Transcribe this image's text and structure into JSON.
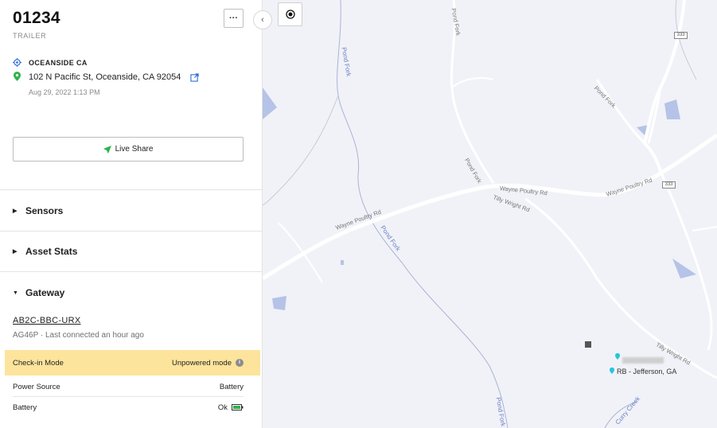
{
  "asset": {
    "id": "01234",
    "type": "TRAILER"
  },
  "location": {
    "name": "OCEANSIDE CA",
    "address": "102 N Pacific St, Oceanside, CA 92054",
    "timestamp": "Aug 29, 2022 1:13 PM"
  },
  "actions": {
    "more_label": "···",
    "live_share_label": "Live Share"
  },
  "sections": [
    {
      "label": "Sensors",
      "expanded": false
    },
    {
      "label": "Asset Stats",
      "expanded": false
    },
    {
      "label": "Gateway",
      "expanded": true
    }
  ],
  "gateway": {
    "id": "AB2C-BBC-URX",
    "meta": "AG46P · Last connected an hour ago",
    "rows": [
      {
        "label": "Check-in Mode",
        "value": "Unpowered mode",
        "highlight": true
      },
      {
        "label": "Power Source",
        "value": "Battery",
        "highlight": false
      },
      {
        "label": "Battery",
        "value": "Ok",
        "highlight": false
      }
    ]
  },
  "map": {
    "roads": [
      "Wayne Poultry Rd",
      "Wayne Poultry Rd",
      "Pond Fork",
      "Pond Fork",
      "Pond Fork",
      "Tilly Wright Rd",
      "Tilly Wright Rd"
    ],
    "creeks": [
      "Pond Fork",
      "Pond Fork",
      "Pond Fork",
      "Curry Creek"
    ],
    "marker_label": "RB - Jefferson, GA",
    "shields": [
      "333",
      "333"
    ]
  },
  "icons": {
    "location": "crosshair-icon",
    "pin": "map-pin-icon",
    "external": "external-link-icon",
    "send": "send-icon",
    "info": "info-icon",
    "battery": "battery-icon",
    "collapse": "chevron-left-icon",
    "locate": "locate-icon"
  },
  "colors": {
    "highlight": "#fde49c",
    "pin": "#2db34a",
    "link": "#2d6cdf",
    "battery": "#2db34a"
  }
}
